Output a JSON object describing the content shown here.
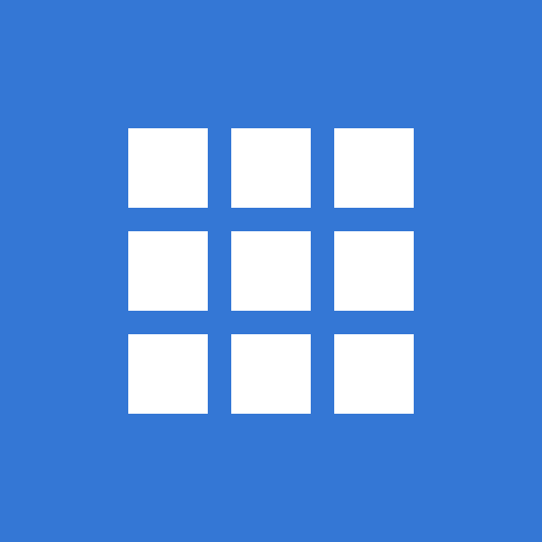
{
  "icon": {
    "name": "apps-grid-icon",
    "background_color": "#3477d5",
    "tile_color": "#ffffff",
    "rows": 3,
    "columns": 3
  }
}
